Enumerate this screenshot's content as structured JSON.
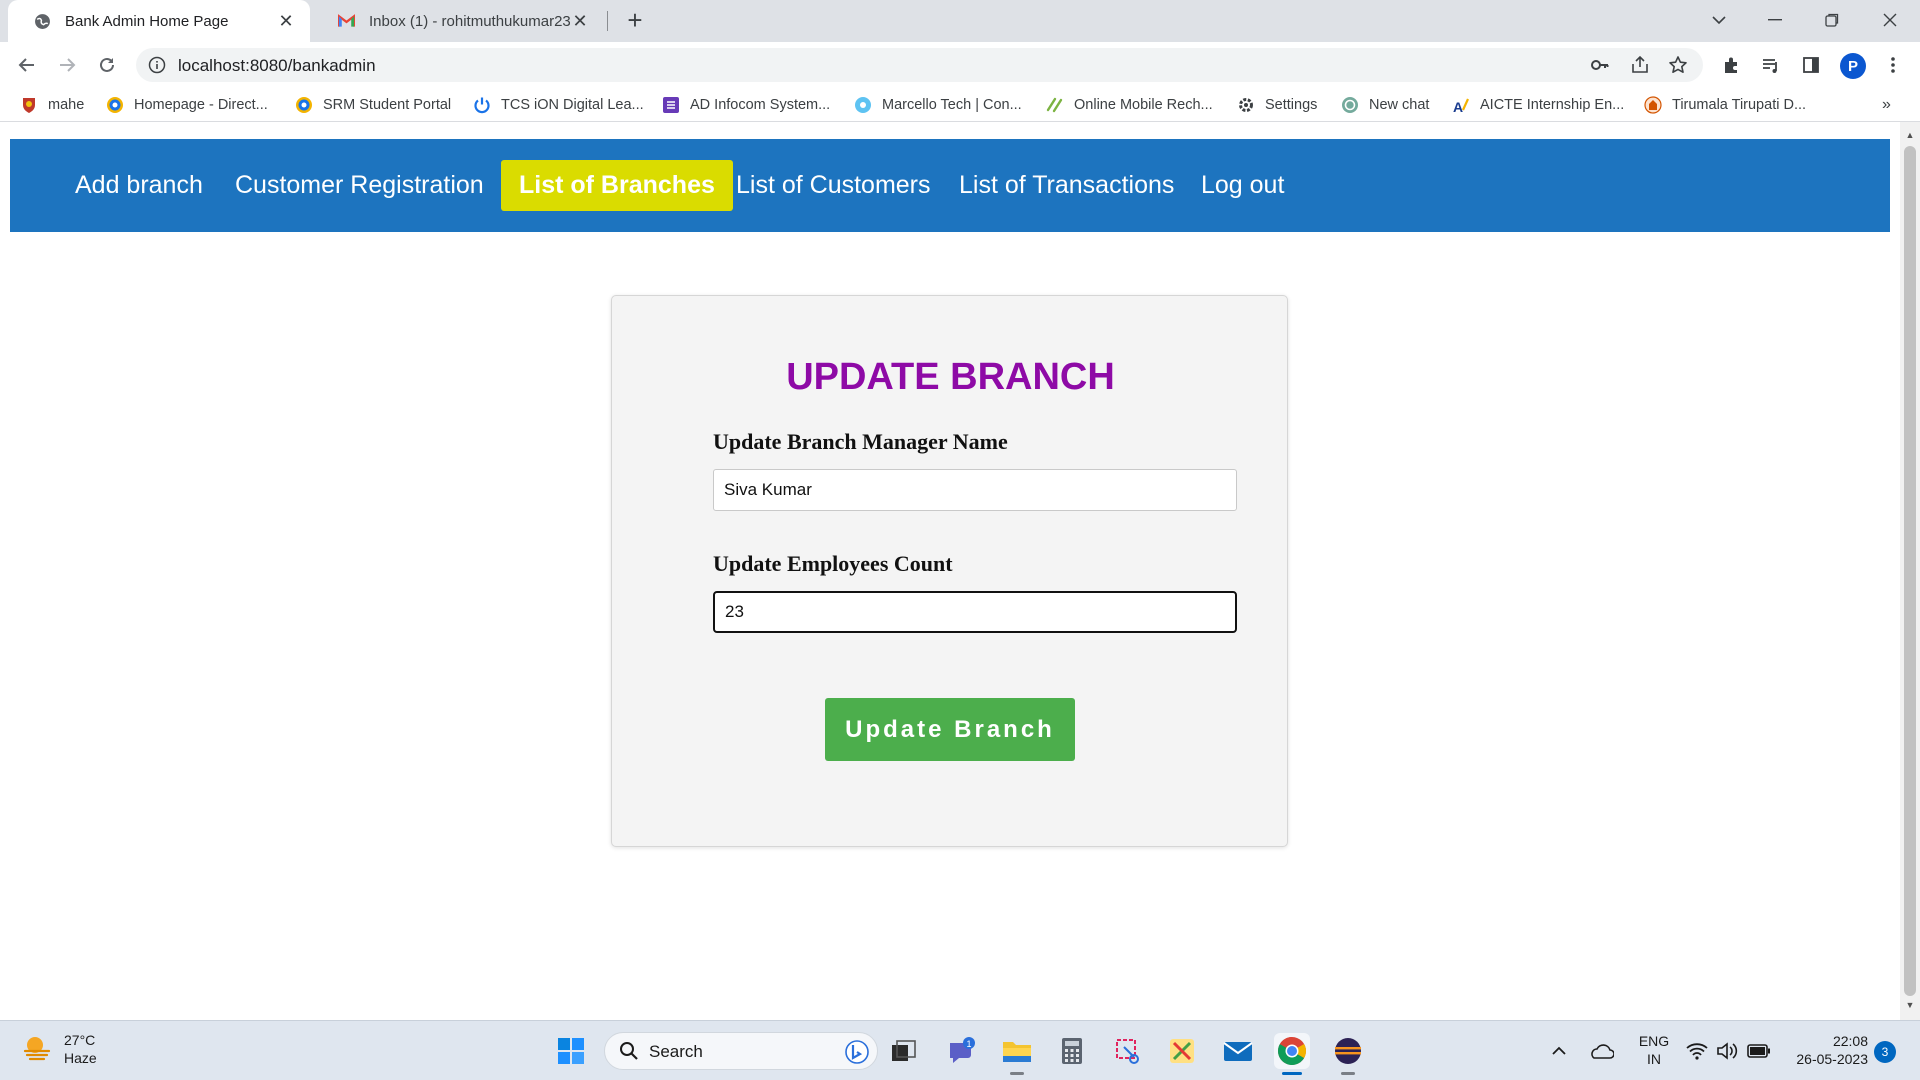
{
  "browser": {
    "tabs": [
      {
        "title": "Bank Admin Home Page",
        "active": true
      },
      {
        "title": "Inbox (1) - rohitmuthukumar23@",
        "active": false
      }
    ],
    "new_tab_label": "+",
    "close_label": "✕",
    "url": "localhost:8080/bankadmin",
    "profile_initial": "P",
    "bookmarks": [
      {
        "label": "mahe",
        "icon": "crest-icon"
      },
      {
        "label": "Homepage - Direct...",
        "icon": "globe-blue-icon"
      },
      {
        "label": "SRM Student Portal",
        "icon": "globe-blue-icon"
      },
      {
        "label": "TCS iON Digital Lea...",
        "icon": "power-icon"
      },
      {
        "label": "AD Infocom System...",
        "icon": "form-icon"
      },
      {
        "label": "Marcello Tech | Con...",
        "icon": "circle-blue-icon"
      },
      {
        "label": "Online Mobile Rech...",
        "icon": "leaf-icon"
      },
      {
        "label": "Settings",
        "icon": "gear-icon"
      },
      {
        "label": "New chat",
        "icon": "chat-icon"
      },
      {
        "label": "AICTE Internship En...",
        "icon": "aicte-icon"
      },
      {
        "label": "Tirumala Tirupati D...",
        "icon": "temple-icon"
      }
    ],
    "bookmarks_more": "»"
  },
  "navbar": {
    "items": [
      {
        "label": "Add branch",
        "active": false
      },
      {
        "label": "Customer Registration",
        "active": false
      },
      {
        "label": "List of Branches",
        "active": true
      },
      {
        "label": "List of Customers",
        "active": false
      },
      {
        "label": "List of Transactions",
        "active": false
      },
      {
        "label": "Log out",
        "active": false
      }
    ]
  },
  "form": {
    "title": "UPDATE BRANCH",
    "manager_label": "Update Branch Manager Name",
    "manager_value": "Siva Kumar",
    "count_label": "Update Employees Count",
    "count_value": "23",
    "submit_label": "Update Branch"
  },
  "taskbar": {
    "weather_temp": "27°C",
    "weather_desc": "Haze",
    "search_label": "Search",
    "chat_badge": "1",
    "lang_top": "ENG",
    "lang_bottom": "IN",
    "time": "22:08",
    "date": "26-05-2023",
    "notification_count": "3"
  },
  "colors": {
    "navbar_bg": "#1d74bf",
    "nav_active_bg": "#dadc00",
    "title_color": "#8e0aa6",
    "button_bg": "#4cae4c"
  }
}
